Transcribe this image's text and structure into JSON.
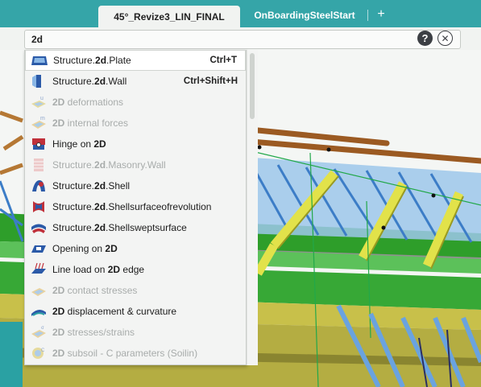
{
  "tabs": [
    {
      "label": "45°_Revize3_LIN_FINAL",
      "active": true
    },
    {
      "label": "OnBoardingSteelStart",
      "active": false
    }
  ],
  "tab_add_symbol": "+",
  "search": {
    "value": "2d"
  },
  "help_symbol": "?",
  "clear_symbol": "✕",
  "menu_items": [
    {
      "pre": "Structure.",
      "bold": "2d",
      "post": ".Plate",
      "shortcut": "Ctrl+T",
      "disabled": false,
      "selected": true,
      "icon": "plate-icon"
    },
    {
      "pre": "Structure.",
      "bold": "2d",
      "post": ".Wall",
      "shortcut": "Ctrl+Shift+H",
      "disabled": false,
      "selected": false,
      "icon": "wall-icon"
    },
    {
      "pre": "",
      "bold": "2D",
      "post": " deformations",
      "shortcut": "",
      "disabled": true,
      "selected": false,
      "icon": "deformations-icon"
    },
    {
      "pre": "",
      "bold": "2D",
      "post": " internal forces",
      "shortcut": "",
      "disabled": true,
      "selected": false,
      "icon": "internal-forces-icon"
    },
    {
      "pre": "Hinge on ",
      "bold": "2D",
      "post": "",
      "shortcut": "",
      "disabled": false,
      "selected": false,
      "icon": "hinge-icon"
    },
    {
      "pre": "Structure.",
      "bold": "2d",
      "post": ".Masonry.Wall",
      "shortcut": "",
      "disabled": true,
      "selected": false,
      "icon": "masonry-wall-icon"
    },
    {
      "pre": "Structure.",
      "bold": "2d",
      "post": ".Shell",
      "shortcut": "",
      "disabled": false,
      "selected": false,
      "icon": "shell-icon"
    },
    {
      "pre": "Structure.",
      "bold": "2d",
      "post": ".Shellsurfaceofrevolution",
      "shortcut": "",
      "disabled": false,
      "selected": false,
      "icon": "shell-revolution-icon"
    },
    {
      "pre": "Structure.",
      "bold": "2d",
      "post": ".Shellsweptsurface",
      "shortcut": "",
      "disabled": false,
      "selected": false,
      "icon": "shell-swept-icon"
    },
    {
      "pre": "Opening on ",
      "bold": "2D",
      "post": "",
      "shortcut": "",
      "disabled": false,
      "selected": false,
      "icon": "opening-icon"
    },
    {
      "pre": "Line load on ",
      "bold": "2D",
      "post": " edge",
      "shortcut": "",
      "disabled": false,
      "selected": false,
      "icon": "line-load-icon"
    },
    {
      "pre": "",
      "bold": "2D",
      "post": " contact stresses",
      "shortcut": "",
      "disabled": true,
      "selected": false,
      "icon": "contact-stresses-icon"
    },
    {
      "pre": "",
      "bold": "2D",
      "post": " displacement & curvature",
      "shortcut": "",
      "disabled": false,
      "selected": false,
      "icon": "displacement-icon"
    },
    {
      "pre": "",
      "bold": "2D",
      "post": " stresses/strains",
      "shortcut": "",
      "disabled": true,
      "selected": false,
      "icon": "stresses-strains-icon"
    },
    {
      "pre": "",
      "bold": "2D",
      "post": " subsoil - C parameters (Soilin)",
      "shortcut": "",
      "disabled": true,
      "selected": false,
      "icon": "subsoil-icon"
    }
  ],
  "colors": {
    "tabbar": "#35a5a8",
    "accent_blue": "#2b63c6",
    "beam_yellow": "#e2e24a",
    "beam_wood": "#9b5a22",
    "slab_green": "#2e9e2a"
  }
}
